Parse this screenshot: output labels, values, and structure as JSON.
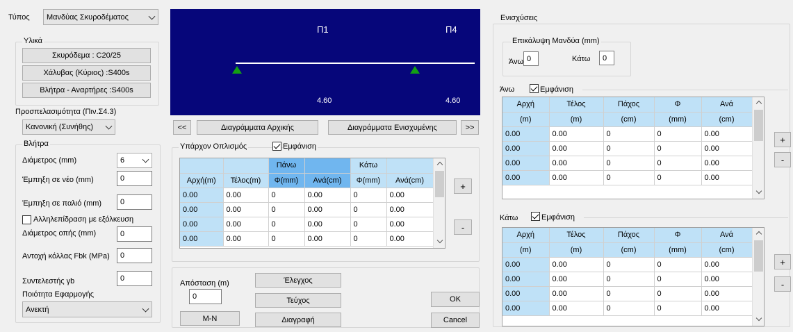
{
  "left": {
    "type_label": "Τύπος",
    "type_value": "Μανδύας Σκυροδέματος",
    "materials_group": "Υλικά",
    "concrete_button": "Σκυρόδεμα : C20/25",
    "steel_button": "Χάλυβας  (Κύριος) :S400s",
    "dowels_button": "Βλήτρα - Αναρτήρες :S400s",
    "accessibility_label": "Προσπελασιμότητα (Πιν.Σ4.3)",
    "accessibility_value": "Κανονική (Συνήθης)",
    "dowels_group": "Βλήτρα",
    "diameter_label": "Διάμετρος (mm)",
    "diameter_value": "6",
    "embed_new_label": "Έμπηξη σε νέο (mm)",
    "embed_new_value": "0",
    "embed_old_label": "Έμπηξη σε παλιό (mm)",
    "embed_old_value": "0",
    "interaction_label": "Αλληλεπίδραση με εξόλκευση",
    "hole_diameter_label": "Διάμετρος οπής (mm)",
    "hole_diameter_value": "0",
    "glue_strength_label": "Αντοχή κόλλας Fbk (MPa)",
    "glue_strength_value": "0",
    "gamma_label": "Συντελεστής γb",
    "gamma_value": "0",
    "quality_label": "Ποιότητα Εφαρμογής",
    "quality_value": "Ανεκτή"
  },
  "diagram": {
    "p1": "Π1",
    "p4": "Π4",
    "len1": "4.60",
    "len2": "4.60",
    "support_color": "#14a014",
    "background": "#06067a"
  },
  "nav": {
    "prev": "<<",
    "initial": "Διαγράμματα Αρχικής",
    "reinforced": "Διαγράμματα Ενισχυμένης",
    "next": ">>"
  },
  "existing": {
    "title": "Υπάρχον Οπλισμός",
    "show_label": "Εμφάνιση",
    "group_top": "Πάνω",
    "group_bottom": "Κάτω",
    "headers": [
      "Αρχή(m)",
      "Τέλος(m)",
      "Φ(mm)",
      "Ανά(cm)",
      "Φ(mm)",
      "Ανά(cm)"
    ],
    "rows": [
      [
        "0.00",
        "0.00",
        "0",
        "0.00",
        "0",
        "0.00"
      ],
      [
        "0.00",
        "0.00",
        "0",
        "0.00",
        "0",
        "0.00"
      ],
      [
        "0.00",
        "0.00",
        "0",
        "0.00",
        "0",
        "0.00"
      ],
      [
        "0.00",
        "0.00",
        "0",
        "0.00",
        "0",
        "0.00"
      ]
    ],
    "add": "+",
    "remove": "-"
  },
  "bottom": {
    "distance_label": "Απόσταση (m)",
    "distance_value": "0",
    "mn": "M-N",
    "check": "Έλεγχος",
    "report": "Τεύχος",
    "delete": "Διαγραφή",
    "ok": "OK",
    "cancel": "Cancel"
  },
  "right": {
    "group_title": "Ενισχύσεις",
    "cover_title": "Επικάλυψη Μανδύα (mm)",
    "top_label": "Άνω",
    "top_value": "0",
    "bottom_label": "Κάτω",
    "bottom_value": "0",
    "upper_title": "Άνω",
    "lower_title": "Κάτω",
    "show_label": "Εμφάνιση",
    "headers1": [
      "Αρχή",
      "Τέλος",
      "Πάχος",
      "Φ",
      "Ανά"
    ],
    "headers2": [
      "(m)",
      "(m)",
      "(cm)",
      "(mm)",
      "(cm)"
    ],
    "upper_rows": [
      [
        "0.00",
        "0.00",
        "0",
        "0",
        "0.00"
      ],
      [
        "0.00",
        "0.00",
        "0",
        "0",
        "0.00"
      ],
      [
        "0.00",
        "0.00",
        "0",
        "0",
        "0.00"
      ],
      [
        "0.00",
        "0.00",
        "0",
        "0",
        "0.00"
      ]
    ],
    "lower_rows": [
      [
        "0.00",
        "0.00",
        "0",
        "0",
        "0.00"
      ],
      [
        "0.00",
        "0.00",
        "0",
        "0",
        "0.00"
      ],
      [
        "0.00",
        "0.00",
        "0",
        "0",
        "0.00"
      ],
      [
        "0.00",
        "0.00",
        "0",
        "0",
        "0.00"
      ]
    ],
    "add": "+",
    "remove": "-"
  }
}
